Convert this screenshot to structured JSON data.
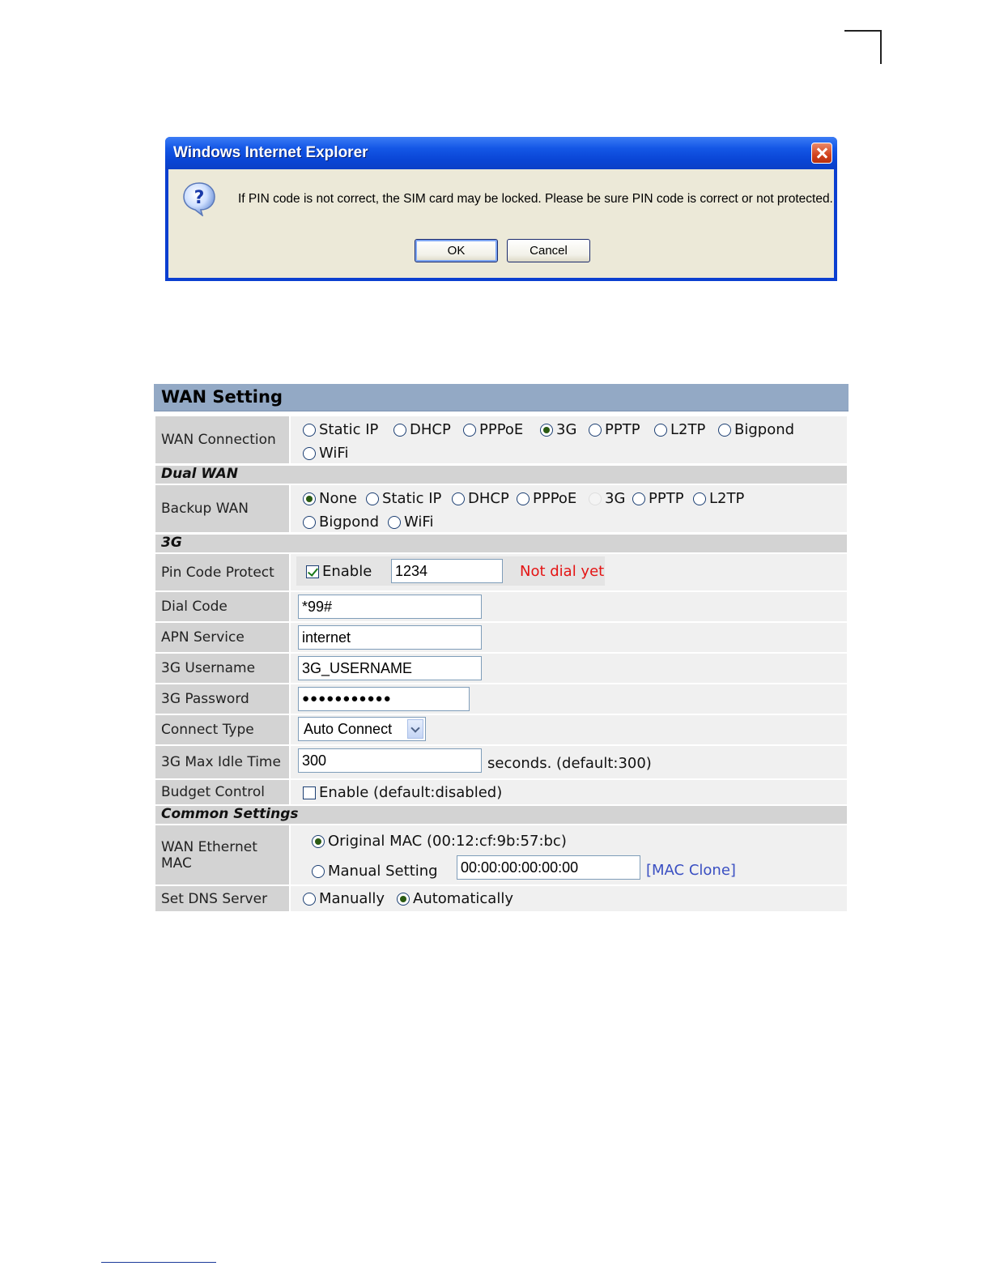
{
  "dialog": {
    "title": "Windows Internet Explorer",
    "icon": "question-icon",
    "message": "If PIN code is not correct, the SIM card may be locked. Please be sure PIN code is correct or not protected.",
    "ok_label": "OK",
    "cancel_label": "Cancel"
  },
  "wan": {
    "title": "WAN Setting",
    "wan_connection": {
      "label": "WAN Connection",
      "options": [
        "Static IP",
        "DHCP",
        "PPPoE",
        "3G",
        "PPTP",
        "L2TP",
        "Bigpond",
        "WiFi"
      ],
      "selected": "3G"
    },
    "dual_wan_section": "Dual WAN",
    "backup_wan": {
      "label": "Backup WAN",
      "options": [
        "None",
        "Static IP",
        "DHCP",
        "PPPoE",
        "3G",
        "PPTP",
        "L2TP",
        "Bigpond",
        "WiFi"
      ],
      "selected": "None",
      "disabled": "3G"
    },
    "threeg_section": "3G",
    "pin_code": {
      "label": "Pin Code Protect",
      "enable_label": "Enable",
      "enabled": true,
      "value": "1234",
      "status": "Not dial yet"
    },
    "dial_code": {
      "label": "Dial Code",
      "value": "*99#"
    },
    "apn_service": {
      "label": "APN Service",
      "value": "internet"
    },
    "username": {
      "label": "3G Username",
      "value": "3G_USERNAME"
    },
    "password": {
      "label": "3G Password",
      "value": "●●●●●●●●●●●"
    },
    "connect_type": {
      "label": "Connect Type",
      "value": "Auto Connect"
    },
    "max_idle": {
      "label": "3G Max Idle Time",
      "value": "300",
      "suffix": "seconds. (default:300)"
    },
    "budget_control": {
      "label": "Budget Control",
      "enable_label": "Enable (default:disabled)",
      "enabled": false
    },
    "common_section": "Common Settings",
    "wan_mac": {
      "label": "WAN Ethernet MAC",
      "original_label": "Original MAC (00:12:cf:9b:57:bc)",
      "manual_label": "Manual Setting",
      "manual_value": "00:00:00:00:00:00",
      "clone_label": "[MAC Clone]",
      "selected": "original"
    },
    "dns": {
      "label": "Set DNS Server",
      "manual_label": "Manually",
      "auto_label": "Automatically",
      "selected": "auto"
    }
  },
  "colors": {
    "header_bg": "#93a9c5",
    "label_bg": "#d3d3d3",
    "status_red": "#e41414",
    "link_blue": "#3a4fc2",
    "dialog_title_blue": "#0a46d6"
  }
}
